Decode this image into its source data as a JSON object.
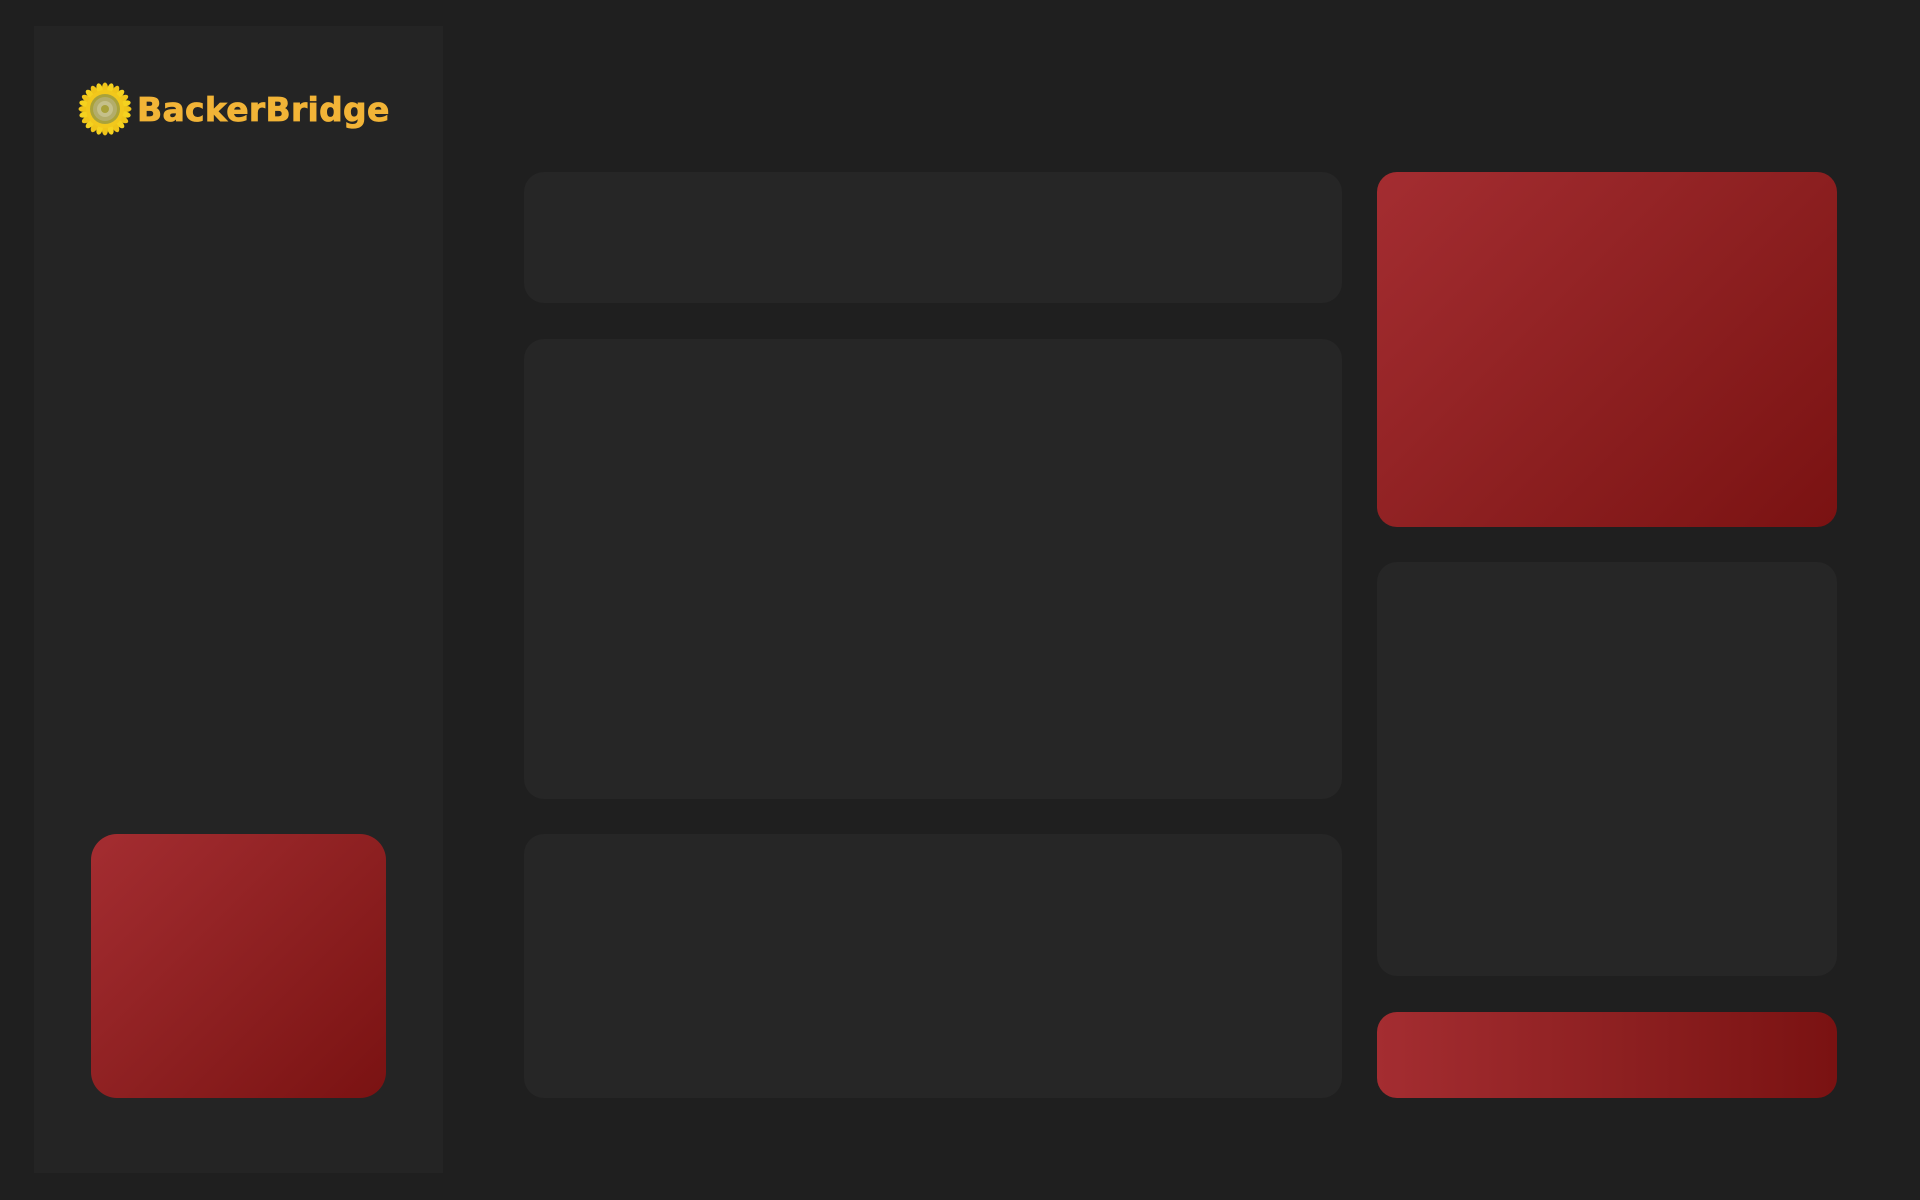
{
  "brand": {
    "name": "BackerBridge",
    "logo_icon": "sunflower-icon"
  },
  "colors": {
    "background": "#1f1f1f",
    "sidebar": "#242424",
    "panel": "#262626",
    "accent_text": "#f2b437",
    "card_red_start": "#a42d31",
    "card_red_end": "#7a1212"
  }
}
